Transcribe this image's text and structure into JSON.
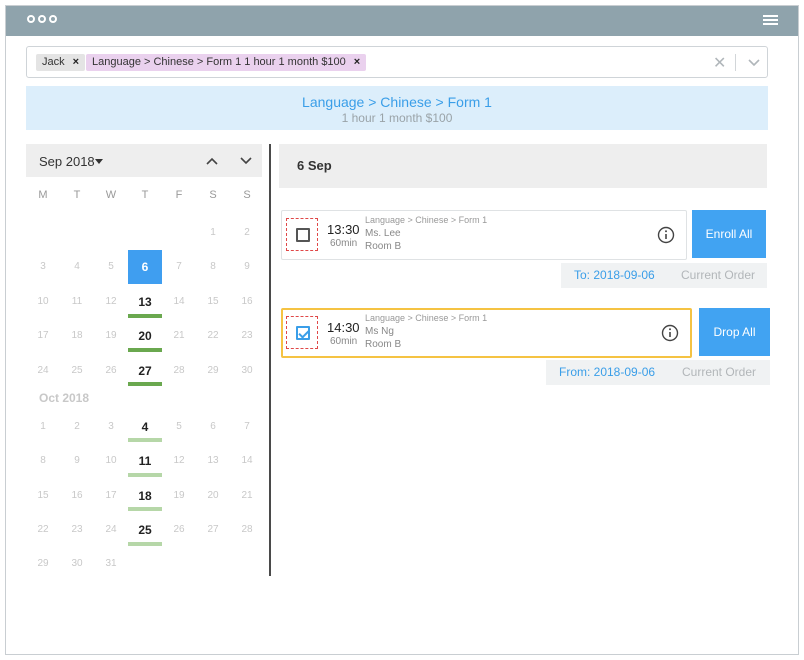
{
  "filter": {
    "tags": [
      {
        "label": "Jack"
      },
      {
        "label": "Language > Chinese > Form 1 1 hour 1 month $100"
      }
    ]
  },
  "banner": {
    "title": "Language > Chinese > Form 1",
    "subtitle": "1 hour 1 month $100"
  },
  "calendar": {
    "month_label": "Sep 2018",
    "weekdays": [
      "M",
      "T",
      "W",
      "T",
      "F",
      "S",
      "S"
    ],
    "oct_label": "Oct 2018",
    "sep_days": [
      "1",
      "2",
      "3",
      "4",
      "5",
      "6",
      "7",
      "8",
      "9",
      "10",
      "11",
      "12",
      "13",
      "14",
      "15",
      "16",
      "17",
      "18",
      "19",
      "20",
      "21",
      "22",
      "23",
      "24",
      "25",
      "26",
      "27",
      "28",
      "29",
      "30"
    ],
    "oct_days": [
      "1",
      "2",
      "3",
      "4",
      "5",
      "6",
      "7",
      "8",
      "9",
      "10",
      "11",
      "12",
      "13",
      "14",
      "15",
      "16",
      "17",
      "18",
      "19",
      "20",
      "21",
      "22",
      "23",
      "24",
      "25",
      "26",
      "27",
      "28",
      "29",
      "30",
      "31"
    ]
  },
  "schedule": {
    "date_title": "6 Sep",
    "sessions": [
      {
        "time": "13:30",
        "duration": "60min",
        "course": "Language > Chinese > Form 1",
        "teacher": "Ms. Lee",
        "room": "Room B",
        "checked": false,
        "action": "Enroll All",
        "date_text": "To: 2018-09-06",
        "order_text": "Current Order"
      },
      {
        "time": "14:30",
        "duration": "60min",
        "course": "Language > Chinese > Form 1",
        "teacher": "Ms Ng",
        "room": "Room B",
        "checked": true,
        "action": "Drop All",
        "date_text": "From: 2018-09-06",
        "order_text": "Current Order"
      }
    ]
  },
  "colors": {
    "accent": "#41a3f2",
    "titlebar": "#8fa3ac",
    "enrolled_bar": "#6aa84f",
    "upcoming_bar": "#b6d7a8",
    "selected_border": "#f5c343"
  }
}
